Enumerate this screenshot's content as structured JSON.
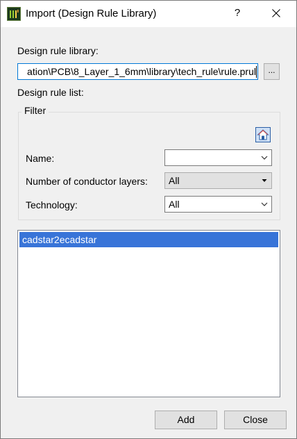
{
  "window": {
    "title": "Import (Design Rule Library)",
    "help_label": "?",
    "app_icon": "app-icon",
    "close_icon": "close-icon"
  },
  "library": {
    "label": "Design rule library:",
    "path_value": "ation\\PCB\\8_Layer_1_6mm\\library\\tech_rule\\rule.prul",
    "browse_label": "..."
  },
  "rule_list": {
    "label": "Design rule list:"
  },
  "filter": {
    "legend": "Filter",
    "home_icon": "home-icon",
    "name_label": "Name:",
    "name_value": "",
    "layers_label": "Number of conductor layers:",
    "layers_value": "All",
    "technology_label": "Technology:",
    "technology_value": "All"
  },
  "list": {
    "items": [
      {
        "label": "cadstar2ecadstar",
        "selected": true
      }
    ]
  },
  "buttons": {
    "add_label": "Add",
    "close_label": "Close"
  },
  "colors": {
    "selection": "#3874d8",
    "focus_border": "#0078d7",
    "dialog_bg": "#f0f0f0"
  }
}
